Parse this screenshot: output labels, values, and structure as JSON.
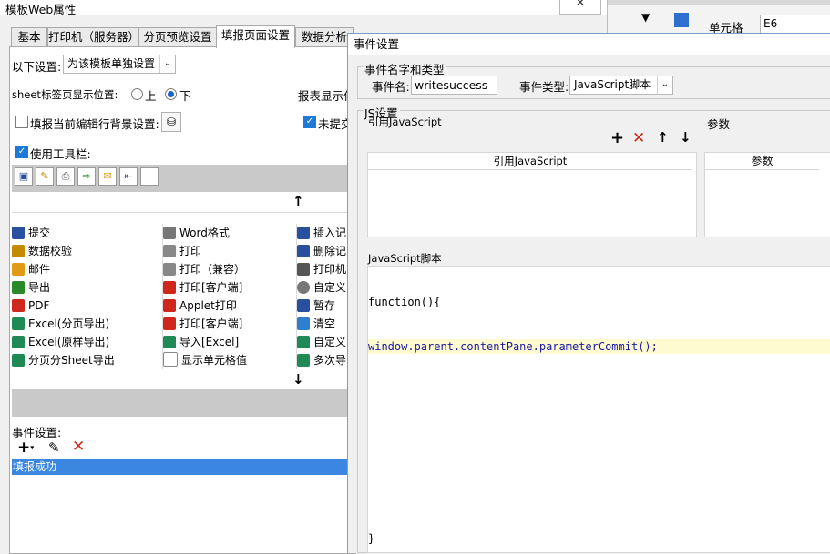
{
  "background_window": {
    "field_label": "单元格",
    "field_value": "E6"
  },
  "window": {
    "title": "模板Web属性",
    "close_glyph": "✕",
    "tabs": [
      "基本",
      "打印机（服务器）",
      "分页预览设置",
      "填报页面设置",
      "数据分析"
    ],
    "active_tab": "填报页面设置"
  },
  "fill_page": {
    "settings_label": "以下设置:",
    "settings_value": "为该模板单独设置",
    "sheet_pos_label": "sheet标签页显示位置:",
    "radio_top": "上",
    "radio_bottom": "下",
    "report_display_label": "报表显示位",
    "fill_bg_label": "填报当前编辑行背景设置:",
    "unsubmit_label": "未提交",
    "use_toolbar_label": "使用工具栏:",
    "up_arrow": "↑",
    "down_arrow": "↓",
    "buttons_col1": [
      "提交",
      "数据校验",
      "邮件",
      "导出",
      "PDF",
      "Excel(分页导出)",
      "Excel(原样导出)",
      "分页分Sheet导出"
    ],
    "buttons_col2": [
      "Word格式",
      "打印",
      "打印（兼容）",
      "打印[客户端]",
      "Applet打印",
      "打印[客户端]",
      "导入[Excel]",
      "显示单元格值"
    ],
    "buttons_col3": [
      "插入记",
      "删除记",
      "打印机",
      "自定义",
      "暂存",
      "清空",
      "自定义",
      "多次导"
    ],
    "event_label": "事件设置:",
    "event_items": [
      "填报成功"
    ]
  },
  "dialog": {
    "title": "事件设置",
    "name_type_group": "事件名字和类型",
    "event_name_label": "事件名:",
    "event_name_value": "writesuccess",
    "event_type_label": "事件类型:",
    "event_type_value": "JavaScript脚本",
    "js_group": "JS设置",
    "ref_js_label": "引用JavaScript",
    "params_label": "参数",
    "ref_js_header": "引用JavaScript",
    "params_header": "参数",
    "script_label": "JavaScript脚本",
    "code_lines": [
      "function(){",
      "window.parent.contentPane.parameterCommit();",
      "}"
    ]
  }
}
